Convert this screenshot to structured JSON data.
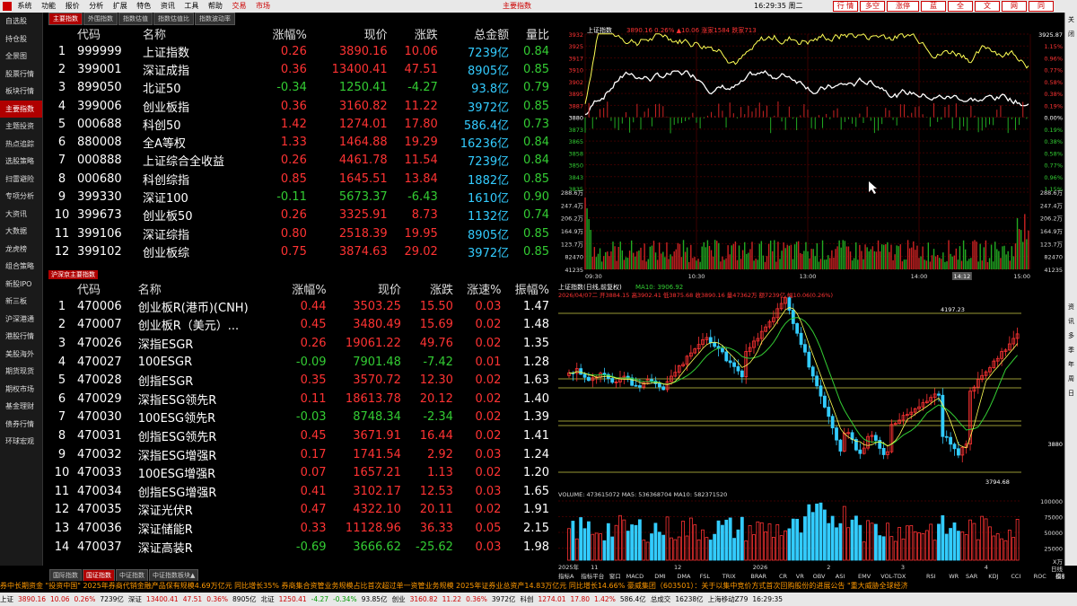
{
  "menu": {
    "items": [
      "系统",
      "功能",
      "报价",
      "分析",
      "扩展",
      "特色",
      "资讯",
      "工具",
      "帮助"
    ],
    "trade": "交易",
    "market": "市场",
    "center_title": "主要指数",
    "clock": "16:29:35 周二",
    "right_buttons": [
      "行 情",
      "多空",
      "涨停",
      "蓝",
      "全",
      "文",
      "网",
      "同"
    ]
  },
  "top_tabs": [
    "主要指数",
    "外围指数",
    "指数估值",
    "指数估值比",
    "指数波动率"
  ],
  "left_nav": [
    "自选股",
    "持仓股",
    "全景图",
    "股票行情",
    "板块行情",
    "主要指数",
    "主题投资",
    "热点追踪",
    "选股策略",
    "扫雷避险",
    "专项分析",
    "大资讯",
    "大数据",
    "龙虎榜",
    "组合策略",
    "新股IPO",
    "新三板",
    "沪深港通",
    "港股行情",
    "美股海外",
    "期货现货",
    "期权市场",
    "基金理财",
    "债券行情",
    "环球宏观"
  ],
  "right_bar": [
    "关闭",
    "",
    "",
    "",
    "",
    "",
    "",
    "",
    "",
    "",
    "",
    "",
    "",
    "",
    "",
    "",
    "",
    "",
    "",
    "",
    "资",
    "讯",
    "多",
    "季",
    "年",
    "周",
    "日",
    "",
    "",
    ""
  ],
  "table1": {
    "headers": [
      "",
      "代码",
      "名称",
      "涨幅%",
      "现价",
      "涨跌",
      "总金额",
      "量比"
    ],
    "rows": [
      [
        "1",
        "999999",
        "上证指数",
        "0.26",
        "3890.16",
        "10.06",
        "7239亿",
        "0.84"
      ],
      [
        "2",
        "399001",
        "深证成指",
        "0.36",
        "13400.41",
        "47.51",
        "8905亿",
        "0.85"
      ],
      [
        "3",
        "899050",
        "北证50",
        "-0.34",
        "1250.41",
        "-4.27",
        "93.8亿",
        "0.79"
      ],
      [
        "4",
        "399006",
        "创业板指",
        "0.36",
        "3160.82",
        "11.22",
        "3972亿",
        "0.85"
      ],
      [
        "5",
        "000688",
        "科创50",
        "1.42",
        "1274.01",
        "17.80",
        "586.4亿",
        "0.73"
      ],
      [
        "6",
        "880008",
        "全A等权",
        "1.33",
        "1464.88",
        "19.29",
        "16236亿",
        "0.84"
      ],
      [
        "7",
        "000888",
        "上证综合全收益",
        "0.26",
        "4461.78",
        "11.54",
        "7239亿",
        "0.84"
      ],
      [
        "8",
        "000680",
        "科创综指",
        "0.85",
        "1645.51",
        "13.84",
        "1882亿",
        "0.85"
      ],
      [
        "9",
        "399330",
        "深证100",
        "-0.11",
        "5673.37",
        "-6.43",
        "1610亿",
        "0.90"
      ],
      [
        "10",
        "399673",
        "创业板50",
        "0.26",
        "3325.91",
        "8.73",
        "1132亿",
        "0.74"
      ],
      [
        "11",
        "399106",
        "深证综指",
        "0.80",
        "2518.39",
        "19.95",
        "8905亿",
        "0.85"
      ],
      [
        "12",
        "399102",
        "创业板综",
        "0.75",
        "3874.63",
        "29.02",
        "3972亿",
        "0.85"
      ]
    ]
  },
  "section2_label": "沪深京主要指数",
  "table2": {
    "headers": [
      "",
      "代码",
      "名称",
      "涨幅%",
      "现价",
      "涨跌",
      "涨速%",
      "振幅%"
    ],
    "rows": [
      [
        "1",
        "470006",
        "创业板R(港币)(CNH)",
        "0.44",
        "3503.25",
        "15.50",
        "0.03",
        "1.47"
      ],
      [
        "2",
        "470007",
        "创业板R（美元）...",
        "0.45",
        "3480.49",
        "15.69",
        "0.02",
        "1.48"
      ],
      [
        "3",
        "470026",
        "深指ESGR",
        "0.26",
        "19061.22",
        "49.76",
        "0.02",
        "1.35"
      ],
      [
        "4",
        "470027",
        "100ESGR",
        "-0.09",
        "7901.48",
        "-7.42",
        "0.01",
        "1.28"
      ],
      [
        "5",
        "470028",
        "创指ESGR",
        "0.35",
        "3570.72",
        "12.30",
        "0.02",
        "1.63"
      ],
      [
        "6",
        "470029",
        "深指ESG领先R",
        "0.11",
        "18613.78",
        "20.12",
        "0.02",
        "1.40"
      ],
      [
        "7",
        "470030",
        "100ESG领先R",
        "-0.03",
        "8748.34",
        "-2.34",
        "0.02",
        "1.39"
      ],
      [
        "8",
        "470031",
        "创指ESG领先R",
        "0.45",
        "3671.91",
        "16.44",
        "0.02",
        "1.41"
      ],
      [
        "9",
        "470032",
        "深指ESG增强R",
        "0.17",
        "1741.54",
        "2.92",
        "0.03",
        "1.24"
      ],
      [
        "10",
        "470033",
        "100ESG增强R",
        "0.07",
        "1657.21",
        "1.13",
        "0.02",
        "1.20"
      ],
      [
        "11",
        "470034",
        "创指ESG增强R",
        "0.41",
        "3102.17",
        "12.53",
        "0.03",
        "1.65"
      ],
      [
        "12",
        "470035",
        "深证光伏R",
        "0.47",
        "4322.10",
        "20.11",
        "0.02",
        "1.91"
      ],
      [
        "13",
        "470036",
        "深证储能R",
        "0.33",
        "11128.96",
        "36.33",
        "0.05",
        "2.15"
      ],
      [
        "14",
        "470037",
        "深证高装R",
        "-0.69",
        "3666.62",
        "-25.62",
        "0.03",
        "1.98"
      ]
    ]
  },
  "bottom_tabs": [
    "国际指数",
    "国证指数",
    "中证指数",
    "中证指数板块▲"
  ],
  "intraday": {
    "title": "上证指数",
    "info": "3890.16 0.26% ▲10.06 涨家1584 跌家713",
    "price_labels_left": [
      "3932",
      "3925",
      "3917",
      "3910",
      "3902",
      "3895",
      "3887",
      "3880",
      "3873",
      "3865",
      "3858",
      "3850",
      "3843",
      "3835"
    ],
    "pct_labels_right": [
      "1.15%",
      "0.96%",
      "0.77%",
      "0.58%",
      "0.38%",
      "0.19%",
      "0.00%",
      "0.19%",
      "0.38%",
      "0.58%",
      "0.77%",
      "0.96%",
      "1.15%"
    ],
    "vol_labels_left": [
      "288.6万",
      "247.4万",
      "206.2万",
      "164.9万",
      "123.7万",
      "82470",
      "41235"
    ],
    "vol_labels_right": [
      "288.6万",
      "247.4万",
      "206.2万",
      "164.9万",
      "123.7万",
      "82470",
      "41235"
    ],
    "time_labels": [
      "09:30",
      "10:30",
      "13:00",
      "14:00",
      "15:00"
    ],
    "cursor_time": "14:12",
    "last_price": "3925.87"
  },
  "kline": {
    "title": "上证指数(日线,前复权)",
    "ma": "MA10: 3906.92",
    "info": "2026/04/07二 开3884.15 高3902.41 低3875.68 收3890.16 量47362万 额7239亿 幅10.06(0.26%)",
    "high_label": "4197.23",
    "low_label": "3794.68",
    "axis_label": "3880",
    "vol_title": "VOLUME: 473615072 MA5: 536368704 MA10: 582371520",
    "vol_axis": [
      "100000",
      "75000",
      "50000",
      "25000"
    ],
    "vol_unit": "X万",
    "x_labels": [
      "2025年",
      "11",
      "12",
      "2026",
      "2",
      "3",
      "4"
    ],
    "indicator_bar": [
      "指标A",
      "指标平台",
      "窗口",
      "MACD",
      "DMI",
      "DMA",
      "FSL",
      "TRIX",
      "BRAR",
      "CR",
      "VR",
      "OBV",
      "ASI",
      "EMV",
      "VOL-TDX",
      "RSI",
      "WR",
      "SAR",
      "KDJ",
      "CCI",
      "ROC",
      "指标B",
      "模板"
    ],
    "period": "日线"
  },
  "ticker": "券中长期资金 \"投资中国\"    2025年券商代销金融产品保有规模4.69万亿元 同比增长35%    券商集合资管业务规模占比首次超过单一资管业务规模    2025年证券业总资产14.83万亿元 同比增长14.66%    豪威集团（603501）：关于以集中竞价方式首次回购股份的进展公告    \"重大威胁全球经济",
  "status": [
    "上证",
    "3890.16",
    "10.06",
    "0.26%",
    "7239亿",
    "深证",
    "13400.41",
    "47.51",
    "0.36%",
    "8905亿",
    "北证",
    "1250.41",
    "-4.27",
    "-0.34%",
    "93.85亿",
    "创业",
    "3160.82",
    "11.22",
    "0.36%",
    "3972亿",
    "科创",
    "1274.01",
    "17.80",
    "1.42%",
    "586.4亿",
    "总成交",
    "16238亿",
    "上海移动Z79",
    "16:29:35"
  ]
}
